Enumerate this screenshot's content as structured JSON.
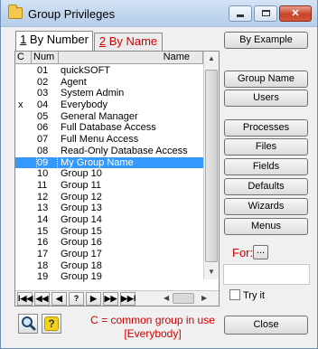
{
  "window": {
    "title": "Group Privileges"
  },
  "tabs": [
    {
      "accel": "1",
      "rest": " By Number",
      "active": true
    },
    {
      "accel": "2",
      "rest": " By Name",
      "active": false
    }
  ],
  "grid": {
    "columns": [
      "C",
      "Num",
      "Name"
    ],
    "rows": [
      {
        "c": "",
        "num": "01",
        "name": "quickSOFT"
      },
      {
        "c": "",
        "num": "02",
        "name": "Agent"
      },
      {
        "c": "",
        "num": "03",
        "name": "System Admin"
      },
      {
        "c": "x",
        "num": "04",
        "name": "Everybody"
      },
      {
        "c": "",
        "num": "05",
        "name": "General Manager"
      },
      {
        "c": "",
        "num": "06",
        "name": "Full Database Access"
      },
      {
        "c": "",
        "num": "07",
        "name": "Full Menu Access"
      },
      {
        "c": "",
        "num": "08",
        "name": "Read-Only Database Access"
      },
      {
        "c": "",
        "num": "09",
        "name": "My Group Name",
        "selected": true
      },
      {
        "c": "",
        "num": "10",
        "name": "Group 10"
      },
      {
        "c": "",
        "num": "11",
        "name": "Group 11"
      },
      {
        "c": "",
        "num": "12",
        "name": "Group 12"
      },
      {
        "c": "",
        "num": "13",
        "name": "Group 13"
      },
      {
        "c": "",
        "num": "14",
        "name": "Group 14"
      },
      {
        "c": "",
        "num": "15",
        "name": "Group 15"
      },
      {
        "c": "",
        "num": "16",
        "name": "Group 16"
      },
      {
        "c": "",
        "num": "17",
        "name": "Group 17"
      },
      {
        "c": "",
        "num": "18",
        "name": "Group 18"
      },
      {
        "c": "",
        "num": "19",
        "name": "Group 19"
      }
    ]
  },
  "nav": {
    "first": "I◀◀",
    "prev_page": "◀◀",
    "prev": "◀",
    "find": "?",
    "next": "▶",
    "next_page": "▶▶",
    "last": "▶▶I"
  },
  "buttons": {
    "by_example": "By Example",
    "group_name": "Group Name",
    "users": "Users",
    "processes": "Processes",
    "files": "Files",
    "fields": "Fields",
    "defaults": "Defaults",
    "wizards": "Wizards",
    "menus": "Menus",
    "for_label": "For:",
    "for_browse": "...",
    "try_it": "Try it",
    "close": "Close"
  },
  "legend": {
    "line1": "C = common group in use",
    "line2": "[Everybody]"
  },
  "colors": {
    "selection": "#3399ff",
    "accent_red": "#d00000"
  }
}
